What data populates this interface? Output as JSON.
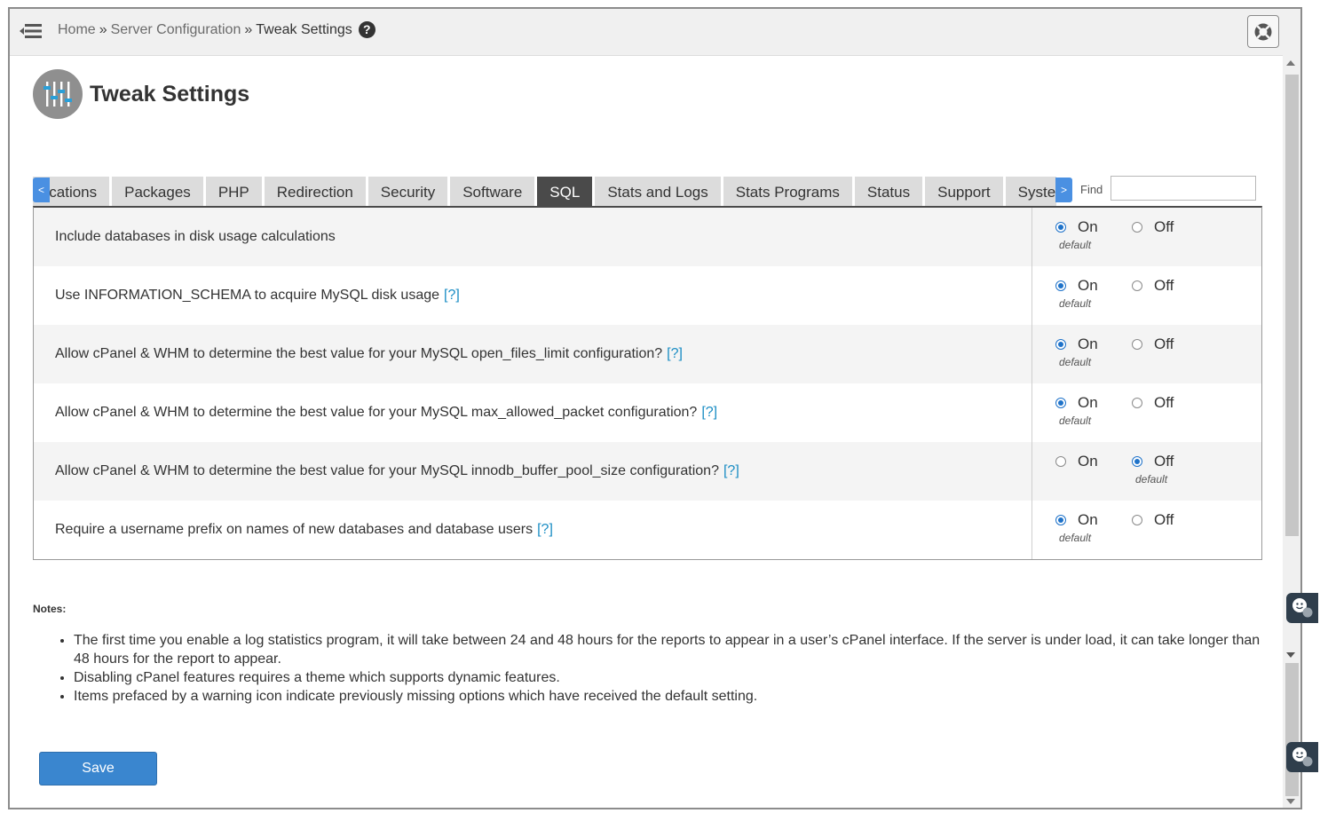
{
  "breadcrumb": {
    "items": [
      "Home",
      "Server Configuration",
      "Tweak Settings"
    ],
    "separator": "»"
  },
  "page": {
    "title": "Tweak Settings"
  },
  "tabs": {
    "items": [
      "Notifications",
      "Packages",
      "PHP",
      "Redirection",
      "Security",
      "Software",
      "SQL",
      "Stats and Logs",
      "Stats Programs",
      "Status",
      "Support",
      "System"
    ],
    "visible": [
      "ifications",
      "Packages",
      "PHP",
      "Redirection",
      "Security",
      "Software",
      "SQL",
      "Stats and Logs",
      "Stats Programs",
      "Status",
      "Support",
      "Syste"
    ],
    "active": "SQL",
    "prev_arrow": "<",
    "next_arrow": ">"
  },
  "find": {
    "label": "Find",
    "value": ""
  },
  "settings": [
    {
      "label": "Include databases in disk usage calculations",
      "help": "",
      "on_label": "On",
      "off_label": "Off",
      "selected": "On",
      "default": "On",
      "default_label": "default"
    },
    {
      "label": "Use INFORMATION_SCHEMA to acquire MySQL disk usage",
      "help": "[?]",
      "on_label": "On",
      "off_label": "Off",
      "selected": "On",
      "default": "On",
      "default_label": "default"
    },
    {
      "label": "Allow cPanel & WHM to determine the best value for your MySQL open_files_limit configuration?",
      "help": "[?]",
      "on_label": "On",
      "off_label": "Off",
      "selected": "On",
      "default": "On",
      "default_label": "default"
    },
    {
      "label": "Allow cPanel & WHM to determine the best value for your MySQL max_allowed_packet configuration?",
      "help": "[?]",
      "on_label": "On",
      "off_label": "Off",
      "selected": "On",
      "default": "On",
      "default_label": "default"
    },
    {
      "label": "Allow cPanel & WHM to determine the best value for your MySQL innodb_buffer_pool_size configuration?",
      "help": "[?]",
      "on_label": "On",
      "off_label": "Off",
      "selected": "Off",
      "default": "Off",
      "default_label": "default"
    },
    {
      "label": "Require a username prefix on names of new databases and database users",
      "help": "[?]",
      "on_label": "On",
      "off_label": "Off",
      "selected": "On",
      "default": "On",
      "default_label": "default"
    }
  ],
  "notes": {
    "title": "Notes:",
    "items": [
      "The first time you enable a log statistics program, it will take between 24 and 48 hours for the reports to appear in a user’s cPanel interface. If the server is under load, it can take longer than 48 hours for the report to appear.",
      "Disabling cPanel features requires a theme which supports dynamic features.",
      "Items prefaced by a warning icon indicate previously missing options which have received the default setting."
    ]
  },
  "save_label": "Save",
  "icons": {
    "menu": "menu-icon",
    "help": "help-icon",
    "support": "lifebuoy-icon",
    "page": "sliders-icon",
    "chat": "chat-face-icon"
  },
  "colors": {
    "accent": "#3a86cf",
    "tab_active": "#4a4a4a",
    "link": "#1a8dc4",
    "radio": "#1e72c9"
  }
}
